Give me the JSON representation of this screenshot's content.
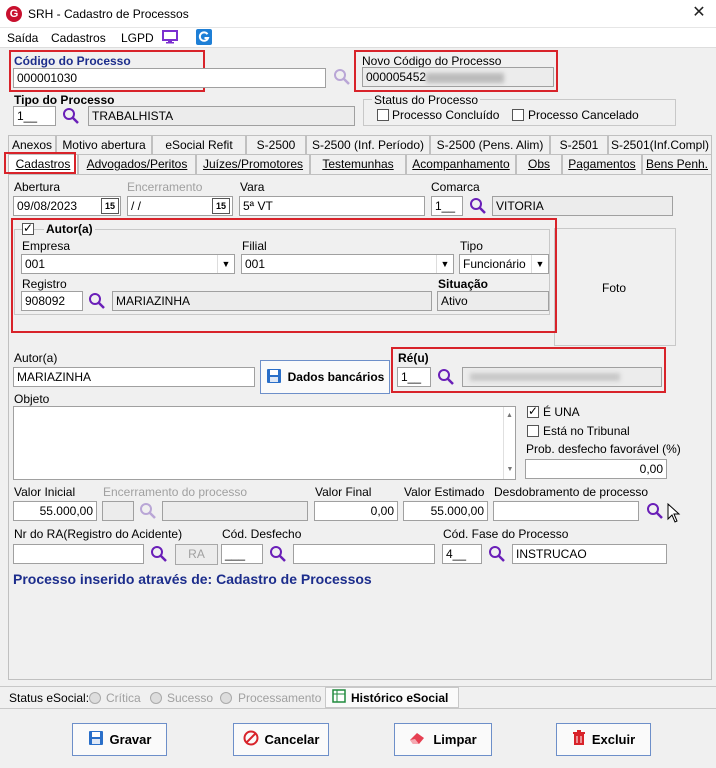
{
  "window": {
    "title": "SRH - Cadastro de Processos",
    "logo": "G"
  },
  "menu": {
    "items": [
      "Saída",
      "Cadastros",
      "LGPD"
    ]
  },
  "header": {
    "codigo_label": "Código do Processo",
    "codigo_value": "000001030",
    "novo_codigo_label": "Novo Código do Processo",
    "novo_codigo_value": "000005452",
    "tipo_label": "Tipo do Processo",
    "tipo_code": "1__",
    "tipo_desc": "TRABALHISTA",
    "status_label": "Status do Processo",
    "concluido_label": "Processo Concluído",
    "cancelado_label": "Processo Cancelado"
  },
  "tabs_row1": [
    "Anexos",
    "Motivo abertura",
    "eSocial Refit",
    "S-2500",
    "S-2500 (Inf. Período)",
    "S-2500 (Pens. Alim)",
    "S-2501",
    "S-2501(Inf.Compl)"
  ],
  "tabs_row2": [
    "Cadastros",
    "Advogados/Peritos",
    "Juízes/Promotores",
    "Testemunhas",
    "Acompanhamento",
    "Obs",
    "Pagamentos",
    "Bens Penh."
  ],
  "form": {
    "abertura_label": "Abertura",
    "abertura_value": "09/08/2023",
    "encerramento_label": "Encerramento",
    "encerramento_value": " /  /",
    "vara_label": "Vara",
    "vara_value": "5ª VT",
    "comarca_label": "Comarca",
    "comarca_code": "1__",
    "comarca_desc": "VITORIA",
    "autor_group_label": "Autor(a)",
    "empresa_label": "Empresa",
    "empresa_value": "001",
    "filial_label": "Filial",
    "filial_value": "001",
    "tipo_label": "Tipo",
    "tipo_value": "Funcionário",
    "registro_label": "Registro",
    "registro_value": "908092",
    "registro_nome": "MARIAZINHA",
    "situacao_label": "Situação",
    "situacao_value": "Ativo",
    "foto_label": "Foto",
    "autor_label": "Autor(a)",
    "autor_value": "MARIAZINHA",
    "dados_bancarios_label": "Dados bancários",
    "reu_label": "Ré(u)",
    "reu_code": "1__",
    "objeto_label": "Objeto",
    "e_una_label": "É UNA",
    "tribunal_label": "Está no Tribunal",
    "prob_label": "Prob. desfecho favorável (%)",
    "prob_value": "0,00",
    "valor_inicial_label": "Valor Inicial",
    "valor_inicial_value": "55.000,00",
    "enc_processo_label": "Encerramento do processo",
    "valor_final_label": "Valor Final",
    "valor_final_value": "0,00",
    "valor_estimado_label": "Valor Estimado",
    "valor_estimado_value": "55.000,00",
    "desdobramento_label": "Desdobramento de processo",
    "nr_ra_label": "Nr do RA(Registro do Acidente)",
    "ra_button": "RA",
    "cod_desfecho_label": "Cód. Desfecho",
    "cod_desfecho_value": "___",
    "cod_fase_label": "Cód. Fase do Processo",
    "cod_fase_code": "4__",
    "cod_fase_desc": "INSTRUCAO",
    "inserted_note": "Processo inserido através de: Cadastro de Processos"
  },
  "statusbar": {
    "label": "Status eSocial:",
    "items": [
      "Crítica",
      "Sucesso",
      "Processamento"
    ],
    "historico_label": "Histórico eSocial"
  },
  "buttons": {
    "gravar": "Gravar",
    "cancelar": "Cancelar",
    "limpar": "Limpar",
    "excluir": "Excluir"
  },
  "colors": {
    "accent_red": "#d8232a",
    "title_blue": "#1c2d8c",
    "magnifier": "#6a1fb8"
  }
}
